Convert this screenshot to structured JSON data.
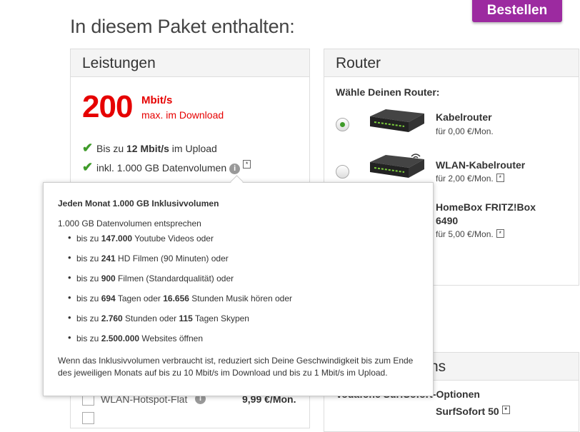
{
  "header": {
    "title": "In diesem Paket enthalten:",
    "order_button": "Bestellen"
  },
  "leistungen": {
    "title": "Leistungen",
    "speed_value": "200",
    "speed_unit": "Mbit/s",
    "speed_sub": "max. im Download",
    "features": [
      {
        "pre": "Bis zu ",
        "bold": "12 Mbit/s",
        "post": " im Upload"
      },
      {
        "text": "inkl. 1.000 GB Datenvolumen",
        "info": "i",
        "star": "*"
      }
    ],
    "hotspot_label": "WLAN-Hotspot-Flat",
    "hotspot_price": "9,99 €/Mon."
  },
  "router": {
    "title": "Router",
    "prompt": "Wähle Deinen Router:",
    "options": [
      {
        "name": "Kabelrouter",
        "price": "für 0,00 €/Mon.",
        "selected": true
      },
      {
        "name": "WLAN-Kabelrouter",
        "price": "für 2,00 €/Mon.",
        "star": "*",
        "selected": false
      },
      {
        "name": "HomeBox FRITZ!Box 6490",
        "price": "für 5,00 €/Mon.",
        "star": "*",
        "selected": false
      }
    ]
  },
  "surfsofort": {
    "title_tail": "ns",
    "subtitle": "Vodafone SurfSofort-Optionen",
    "option": "SurfSofort 50",
    "star": "*"
  },
  "popup": {
    "title": "Jeden Monat 1.000 GB Inklusivvolumen",
    "intro": "1.000 GB Datenvolumen entsprechen",
    "items": [
      [
        {
          "t": "bis zu "
        },
        {
          "b": "147.000"
        },
        {
          "t": " Youtube Videos oder"
        }
      ],
      [
        {
          "t": "bis zu "
        },
        {
          "b": "241"
        },
        {
          "t": " HD Filmen (90 Minuten) oder"
        }
      ],
      [
        {
          "t": "bis zu "
        },
        {
          "b": "900"
        },
        {
          "t": " Filmen (Standardqualität) oder"
        }
      ],
      [
        {
          "t": "bis zu "
        },
        {
          "b": "694"
        },
        {
          "t": " Tagen oder "
        },
        {
          "b": "16.656"
        },
        {
          "t": " Stunden Musik hören oder"
        }
      ],
      [
        {
          "t": "bis zu "
        },
        {
          "b": "2.760"
        },
        {
          "t": " Stunden oder "
        },
        {
          "b": "115"
        },
        {
          "t": " Tagen Skypen"
        }
      ],
      [
        {
          "t": "bis zu "
        },
        {
          "b": "2.500.000"
        },
        {
          "t": " Websites öffnen"
        }
      ]
    ],
    "footer": "Wenn das Inklusivvolumen verbraucht ist, reduziert sich Deine Geschwindigkeit bis zum Ende des jeweiligen Monats auf bis zu 10 Mbit/s im Download und bis zu 1 Mbit/s im Upload."
  },
  "colors": {
    "brand_red": "#e60000",
    "accent_purple": "#9c2aa0",
    "check_green": "#3f9b2a"
  },
  "icons": {
    "check": "check-icon",
    "info": "info-icon",
    "router": "router-icon"
  }
}
